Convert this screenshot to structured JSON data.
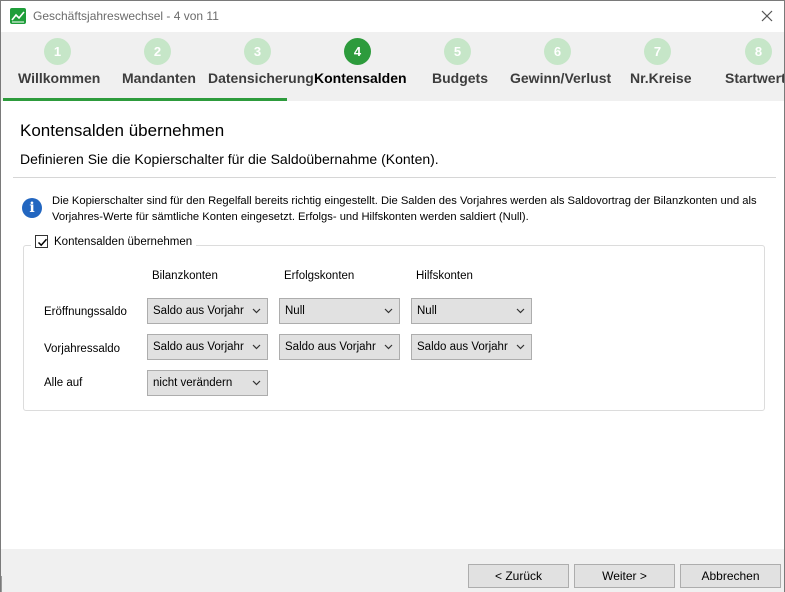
{
  "window": {
    "title": "Geschäftsjahreswechsel - 4 von 11",
    "icon": "chart-app-icon"
  },
  "colors": {
    "accent": "#2d9b3c",
    "step_inactive": "#c6e6c8",
    "info": "#2266c0",
    "button_bg": "#e1e1e1"
  },
  "steps": [
    {
      "number": "1",
      "label": "Willkommen"
    },
    {
      "number": "2",
      "label": "Mandanten"
    },
    {
      "number": "3",
      "label": "Datensicherung"
    },
    {
      "number": "4",
      "label": "Kontensalden"
    },
    {
      "number": "5",
      "label": "Budgets"
    },
    {
      "number": "6",
      "label": "Gewinn/Verlust"
    },
    {
      "number": "7",
      "label": "Nr.Kreise"
    },
    {
      "number": "8",
      "label": "Startwert"
    }
  ],
  "active_step": 4,
  "content": {
    "title": "Kontensalden übernehmen",
    "subtitle": "Definieren Sie die Kopierschalter für die Saldoübernahme (Konten).",
    "info": "Die Kopierschalter sind für den Regelfall bereits richtig eingestellt. Die Salden des Vorjahres werden als Saldovortrag der Bilanzkonten und als Vorjahres-Werte für sämtliche Konten eingesetzt. Erfolgs- und Hilfskonten werden saldiert (Null)."
  },
  "group": {
    "checkbox_label": "Kontensalden übernehmen",
    "checked": true,
    "columns": [
      "Bilanzkonten",
      "Erfolgskonten",
      "Hilfskonten"
    ],
    "rows": [
      {
        "label": "Eröffnungssaldo",
        "values": [
          "Saldo aus Vorjahr",
          "Null",
          "Null"
        ]
      },
      {
        "label": "Vorjahressaldo",
        "values": [
          "Saldo aus Vorjahr",
          "Saldo aus Vorjahr",
          "Saldo aus Vorjahr"
        ]
      },
      {
        "label": "Alle auf",
        "values": [
          "nicht verändern"
        ]
      }
    ]
  },
  "footer": {
    "back_label": "< Zurück",
    "next_label": "Weiter >",
    "cancel_label": "Abbrechen"
  }
}
